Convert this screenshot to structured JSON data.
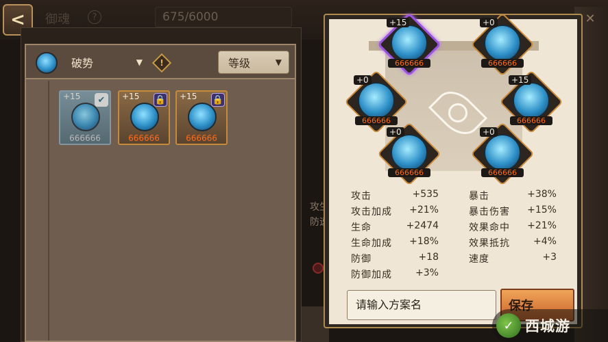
{
  "header": {
    "title": "御魂",
    "help_icon": "?",
    "counter": "675/6000",
    "back_label": "<"
  },
  "filters": {
    "type_label": "破势",
    "sort_label": "等级",
    "warn_icon": "!"
  },
  "inventory": [
    {
      "level": "+15",
      "stars": "666666",
      "badge": "✔",
      "badge_icon": "check-icon",
      "selected": true
    },
    {
      "level": "+15",
      "stars": "666666",
      "badge": "🔒",
      "badge_icon": "lock-icon",
      "selected": false
    },
    {
      "level": "+15",
      "stars": "666666",
      "badge": "🔒",
      "badge_icon": "lock-icon",
      "selected": false
    }
  ],
  "slots": [
    {
      "level": "+15",
      "stars": "666666",
      "active": true
    },
    {
      "level": "+0",
      "stars": "666666",
      "active": false
    },
    {
      "level": "+0",
      "stars": "666666",
      "active": false
    },
    {
      "level": "+15",
      "stars": "666666",
      "active": false
    },
    {
      "level": "+0",
      "stars": "666666",
      "active": false
    },
    {
      "level": "+0",
      "stars": "666666",
      "active": false
    }
  ],
  "stats_left": [
    {
      "label": "攻击",
      "value": "+535"
    },
    {
      "label": "攻击加成",
      "value": "+21%"
    },
    {
      "label": "生命",
      "value": "+2474"
    },
    {
      "label": "生命加成",
      "value": "+18%"
    },
    {
      "label": "防御",
      "value": "+18"
    },
    {
      "label": "防御加成",
      "value": "+3%"
    }
  ],
  "stats_right": [
    {
      "label": "暴击",
      "value": "+38%"
    },
    {
      "label": "暴击伤害",
      "value": "+15%"
    },
    {
      "label": "效果命中",
      "value": "+21%"
    },
    {
      "label": "效果抵抗",
      "value": "+4%"
    },
    {
      "label": "速度",
      "value": "+3"
    }
  ],
  "plan": {
    "input_value": "请输入方案名",
    "save_label": "保存"
  },
  "peek_text": "攻生防速",
  "watermark": {
    "logo": "✓",
    "text": "西城游"
  },
  "colors": {
    "accent_orange": "#c8893b",
    "active_purple": "#9b55e0",
    "parchment": "#efe6d5",
    "star_orange": "#ff6a1a"
  }
}
